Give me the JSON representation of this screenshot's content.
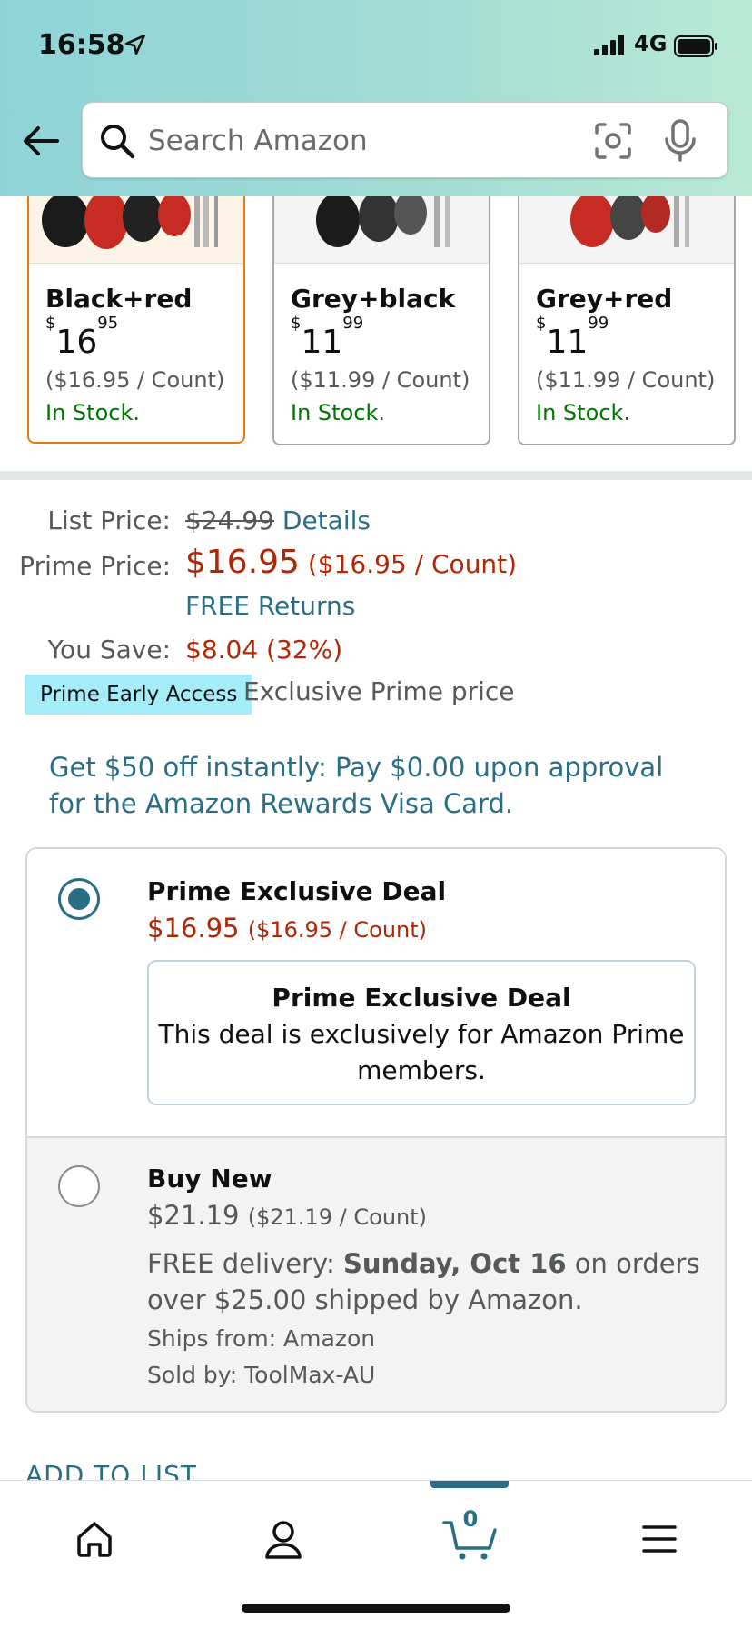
{
  "status": {
    "time": "16:58",
    "network": "4G"
  },
  "search": {
    "placeholder": "Search Amazon"
  },
  "variants": [
    {
      "name": "Black+red",
      "price_whole": "16",
      "price_cents": "95",
      "unit_price": "($16.95 / Count)",
      "stock": "In Stock.",
      "selected": true
    },
    {
      "name": "Grey+black",
      "price_whole": "11",
      "price_cents": "99",
      "unit_price": "($11.99 / Count)",
      "stock": "In Stock.",
      "selected": false
    },
    {
      "name": "Grey+red",
      "price_whole": "11",
      "price_cents": "99",
      "unit_price": "($11.99 / Count)",
      "stock": "In Stock.",
      "selected": false
    }
  ],
  "pricing": {
    "list_label": "List Price:",
    "list_value": "$24.99",
    "details_link": "Details",
    "prime_label": "Prime Price:",
    "prime_value": "$16.95",
    "prime_unit": "($16.95 / Count)",
    "free_returns": "FREE Returns",
    "save_label": "You Save:",
    "save_value": "$8.04 (32%)",
    "badge": "Prime Early Access",
    "badge_text": "Exclusive Prime price"
  },
  "promo": "Get $50 off instantly: Pay $0.00 upon approval for the Amazon Rewards Visa Card.",
  "options": {
    "deal": {
      "title": "Prime Exclusive Deal",
      "price": "$16.95",
      "unit": "($16.95 / Count)",
      "box_title": "Prime Exclusive Deal",
      "box_text": "This deal is exclusively for Amazon Prime members."
    },
    "new": {
      "title": "Buy New",
      "price": "$21.19",
      "unit": "($21.19 / Count)",
      "delivery_prefix": "FREE delivery:",
      "delivery_date": "Sunday, Oct 16",
      "delivery_suffix": "on orders over $25.00 shipped by Amazon.",
      "ships_from": "Ships from: Amazon",
      "sold_by": "Sold by: ToolMax-AU"
    }
  },
  "add_to_list": "ADD TO LIST",
  "nav": {
    "cart_count": "0"
  },
  "colors": {
    "accent": "#2a6e86",
    "price_red": "#b12704",
    "in_stock": "#007600",
    "selected_border": "#e47911",
    "badge": "#a3ecf8"
  },
  "icons": [
    "back-arrow-icon",
    "search-icon",
    "camera-icon",
    "mic-icon",
    "home-icon",
    "account-icon",
    "cart-icon",
    "menu-icon"
  ]
}
